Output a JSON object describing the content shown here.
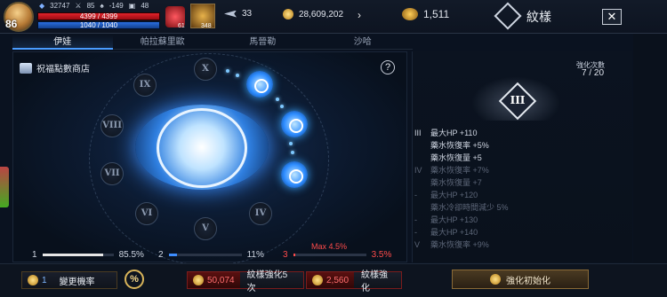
{
  "player": {
    "level": "86",
    "combat_power": "32747",
    "stat_a": "85",
    "stat_b": "-149",
    "stat_c": "48",
    "hp": "4399 / 4399",
    "mp": "1040 / 1040"
  },
  "quick": {
    "potion_count": "61",
    "skill_count": "348"
  },
  "currency": {
    "feather": "33",
    "gold": "28,609,202",
    "gem": "1,511"
  },
  "window": {
    "title": "紋樣",
    "close": "✕"
  },
  "tabs": [
    "伊娃",
    "帕拉蘇里歐",
    "馬晉勒",
    "沙哈"
  ],
  "active_tab": 0,
  "shop_label": "祝福點數商店",
  "help_label": "?",
  "numerals": [
    "X",
    "IX",
    "VIII",
    "VII",
    "VI",
    "V",
    "IV"
  ],
  "progress": [
    {
      "index": "1",
      "value": "85.5%",
      "color": "#e6e6e6",
      "fraction": 0.855
    },
    {
      "index": "2",
      "value": "11%",
      "color": "#3e8eff",
      "fraction": 0.11
    },
    {
      "index": "3",
      "value": "3.5%",
      "color": "#ff4b4b",
      "fraction": 0.035
    }
  ],
  "max_text": "Max 4.5%",
  "enhance": {
    "count_label": "強化次數",
    "count_value": "7 / 20",
    "tier": "III"
  },
  "stats": [
    {
      "tier": "III",
      "text": "最大HP +110",
      "dim": false
    },
    {
      "tier": "",
      "text": "藥水恢復率 +5%",
      "dim": false
    },
    {
      "tier": "",
      "text": "藥水恢復量 +5",
      "dim": false
    },
    {
      "tier": "IV",
      "text": "藥水恢復率 +7%",
      "dim": true
    },
    {
      "tier": "",
      "text": "藥水恢復量 +7",
      "dim": true
    },
    {
      "tier": "-",
      "text": "最大HP +120",
      "dim": true
    },
    {
      "tier": "",
      "text": "藥水冷卻時間減少 5%",
      "dim": true
    },
    {
      "tier": "-",
      "text": "最大HP +130",
      "dim": true
    },
    {
      "tier": "-",
      "text": "最大HP +140",
      "dim": true
    },
    {
      "tier": "V",
      "text": "藥水恢復率 +9%",
      "dim": true
    }
  ],
  "buttons": {
    "change_rate": {
      "cost": "1",
      "label": "變更機率"
    },
    "percent": "%",
    "enhance5": {
      "cost": "50,074",
      "label": "紋樣強化5次"
    },
    "enhance1": {
      "cost": "2,560",
      "label": "紋樣強化"
    },
    "reset": {
      "label": "強化初始化"
    }
  },
  "colors": {
    "accent": "#4a9cff",
    "danger": "#ff4b4b",
    "gold": "#d8b45a"
  }
}
